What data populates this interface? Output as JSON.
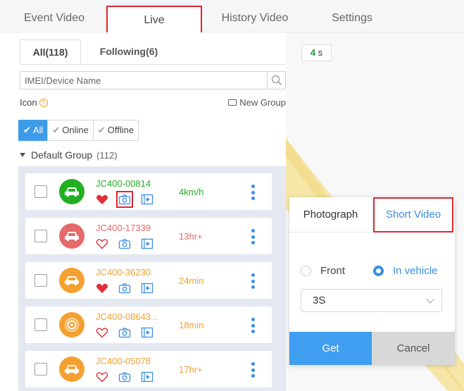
{
  "top_tabs": [
    {
      "label": "Event Video"
    },
    {
      "label": "Live",
      "active": true
    },
    {
      "label": "History Video"
    },
    {
      "label": "Settings"
    }
  ],
  "sub_tabs": [
    {
      "label": "All(118)",
      "active": true
    },
    {
      "label": "Following(6)"
    }
  ],
  "search": {
    "placeholder": "IMEI/Device Name",
    "value": ""
  },
  "icon_label": "Icon",
  "new_group_label": "New Group",
  "filters": [
    {
      "label": "All",
      "active": true
    },
    {
      "label": "Online"
    },
    {
      "label": "Offline"
    }
  ],
  "group": {
    "name": "Default Group",
    "count": "(112)"
  },
  "devices": [
    {
      "name": "JC400-00814",
      "status": "4km/h",
      "color": "#22b022",
      "text_color": "#22b022",
      "stat_color": "#22b022",
      "avatar_icon": "car-icon",
      "favorite": true,
      "camera_highlighted": true
    },
    {
      "name": "JC400-17339",
      "status": "13hr+",
      "color": "#e66a6a",
      "text_color": "#e66a6a",
      "stat_color": "#e66a6a",
      "avatar_icon": "car-icon",
      "favorite": false,
      "camera_highlighted": false
    },
    {
      "name": "JC400-36230",
      "status": "24min",
      "color": "#f5a030",
      "text_color": "#f0a030",
      "stat_color": "#f0a030",
      "avatar_icon": "car-icon",
      "favorite": true,
      "camera_highlighted": false
    },
    {
      "name": "JC400-08643...",
      "status": "18min",
      "color": "#f5a030",
      "text_color": "#f0a030",
      "stat_color": "#f0a030",
      "avatar_icon": "target-icon",
      "favorite": false,
      "camera_highlighted": false
    },
    {
      "name": "JC400-05078",
      "status": "17hr+",
      "color": "#f5a030",
      "text_color": "#f0a030",
      "stat_color": "#f0a030",
      "avatar_icon": "car-icon",
      "favorite": false,
      "camera_highlighted": false
    }
  ],
  "timer": {
    "value": "4",
    "unit": "s"
  },
  "popup": {
    "tabs": [
      {
        "label": "Photograph"
      },
      {
        "label": "Short Video",
        "active": true
      }
    ],
    "radios": [
      {
        "label": "Front",
        "checked": false
      },
      {
        "label": "In vehicle",
        "checked": true
      }
    ],
    "duration": "3S",
    "get_label": "Get",
    "cancel_label": "Cancel"
  },
  "colors": {
    "accent": "#3a8ee6",
    "highlight_border": "#e0262d",
    "favorite": "#e0303a",
    "map_road": "#f6e6a8"
  }
}
